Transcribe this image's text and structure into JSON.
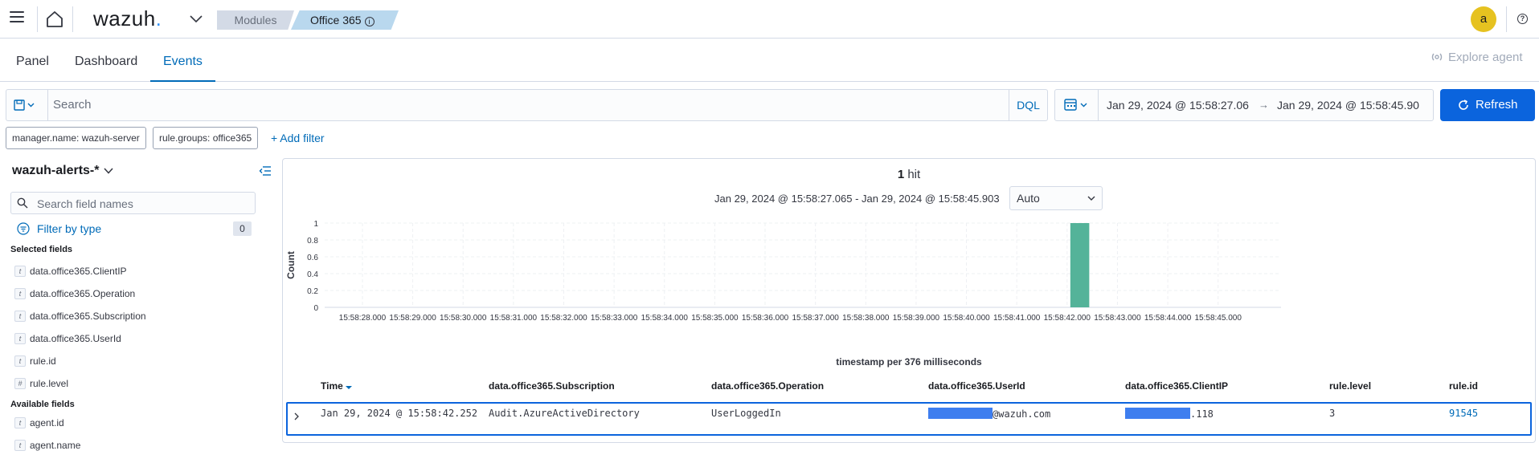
{
  "header": {
    "logo_text": "wazuh",
    "breadcrumbs": [
      "Modules",
      "Office 365"
    ],
    "avatar_letter": "a"
  },
  "tabs": [
    {
      "label": "Panel",
      "active": false
    },
    {
      "label": "Dashboard",
      "active": false
    },
    {
      "label": "Events",
      "active": true
    }
  ],
  "explore_agent_label": "Explore agent",
  "search": {
    "placeholder": "Search",
    "language": "DQL"
  },
  "time_range": {
    "start": "Jan 29, 2024 @ 15:58:27.06",
    "arrow": "→",
    "end": "Jan 29, 2024 @ 15:58:45.90"
  },
  "refresh_label": "Refresh",
  "filters": [
    "manager.name: wazuh-server",
    "rule.groups: office365"
  ],
  "add_filter_label": "+ Add filter",
  "sidebar": {
    "index_pattern": "wazuh-alerts-*",
    "field_search_placeholder": "Search field names",
    "filter_by_type_label": "Filter by type",
    "filter_count": "0",
    "selected_title": "Selected fields",
    "selected_fields": [
      {
        "type": "t",
        "name": "data.office365.ClientIP"
      },
      {
        "type": "t",
        "name": "data.office365.Operation"
      },
      {
        "type": "t",
        "name": "data.office365.Subscription"
      },
      {
        "type": "t",
        "name": "data.office365.UserId"
      },
      {
        "type": "t",
        "name": "rule.id"
      },
      {
        "type": "#",
        "name": "rule.level"
      }
    ],
    "available_title": "Available fields",
    "available_fields": [
      {
        "type": "t",
        "name": "agent.id"
      },
      {
        "type": "t",
        "name": "agent.name"
      }
    ]
  },
  "results": {
    "hit_count": "1",
    "hit_word": "hit",
    "range_text": "Jan 29, 2024 @ 15:58:27.065 - Jan 29, 2024 @ 15:58:45.903",
    "interval": "Auto"
  },
  "chart_data": {
    "type": "bar",
    "ylabel": "Count",
    "xlabel": "timestamp per 376 milliseconds",
    "ylim": [
      0,
      1
    ],
    "yticks": [
      "0",
      "0.2",
      "0.4",
      "0.6",
      "0.8",
      "1"
    ],
    "xticks": [
      "15:58:28.000",
      "15:58:29.000",
      "15:58:30.000",
      "15:58:31.000",
      "15:58:32.000",
      "15:58:33.000",
      "15:58:34.000",
      "15:58:35.000",
      "15:58:36.000",
      "15:58:37.000",
      "15:58:38.000",
      "15:58:39.000",
      "15:58:40.000",
      "15:58:41.000",
      "15:58:42.000",
      "15:58:43.000",
      "15:58:44.000",
      "15:58:45.000"
    ],
    "bars": [
      {
        "x": "15:58:42.252",
        "value": 1
      }
    ],
    "color": "#54b399",
    "grid": true
  },
  "table": {
    "columns": [
      "Time",
      "data.office365.Subscription",
      "data.office365.Operation",
      "data.office365.UserId",
      "data.office365.ClientIP",
      "rule.level",
      "rule.id"
    ],
    "rows": [
      {
        "time": "Jan 29, 2024 @ 15:58:42.252",
        "subscription": "Audit.AzureActiveDirectory",
        "operation": "UserLoggedIn",
        "userid_suffix": "@wazuh.com",
        "clientip_suffix": ".118",
        "rule_level": "3",
        "rule_id": "91545"
      }
    ]
  },
  "colors": {
    "accent": "#006bb8",
    "primary_button": "#0b64dd",
    "bar": "#54b399",
    "avatar": "#e6c220",
    "redaction": "#3e7eef"
  }
}
